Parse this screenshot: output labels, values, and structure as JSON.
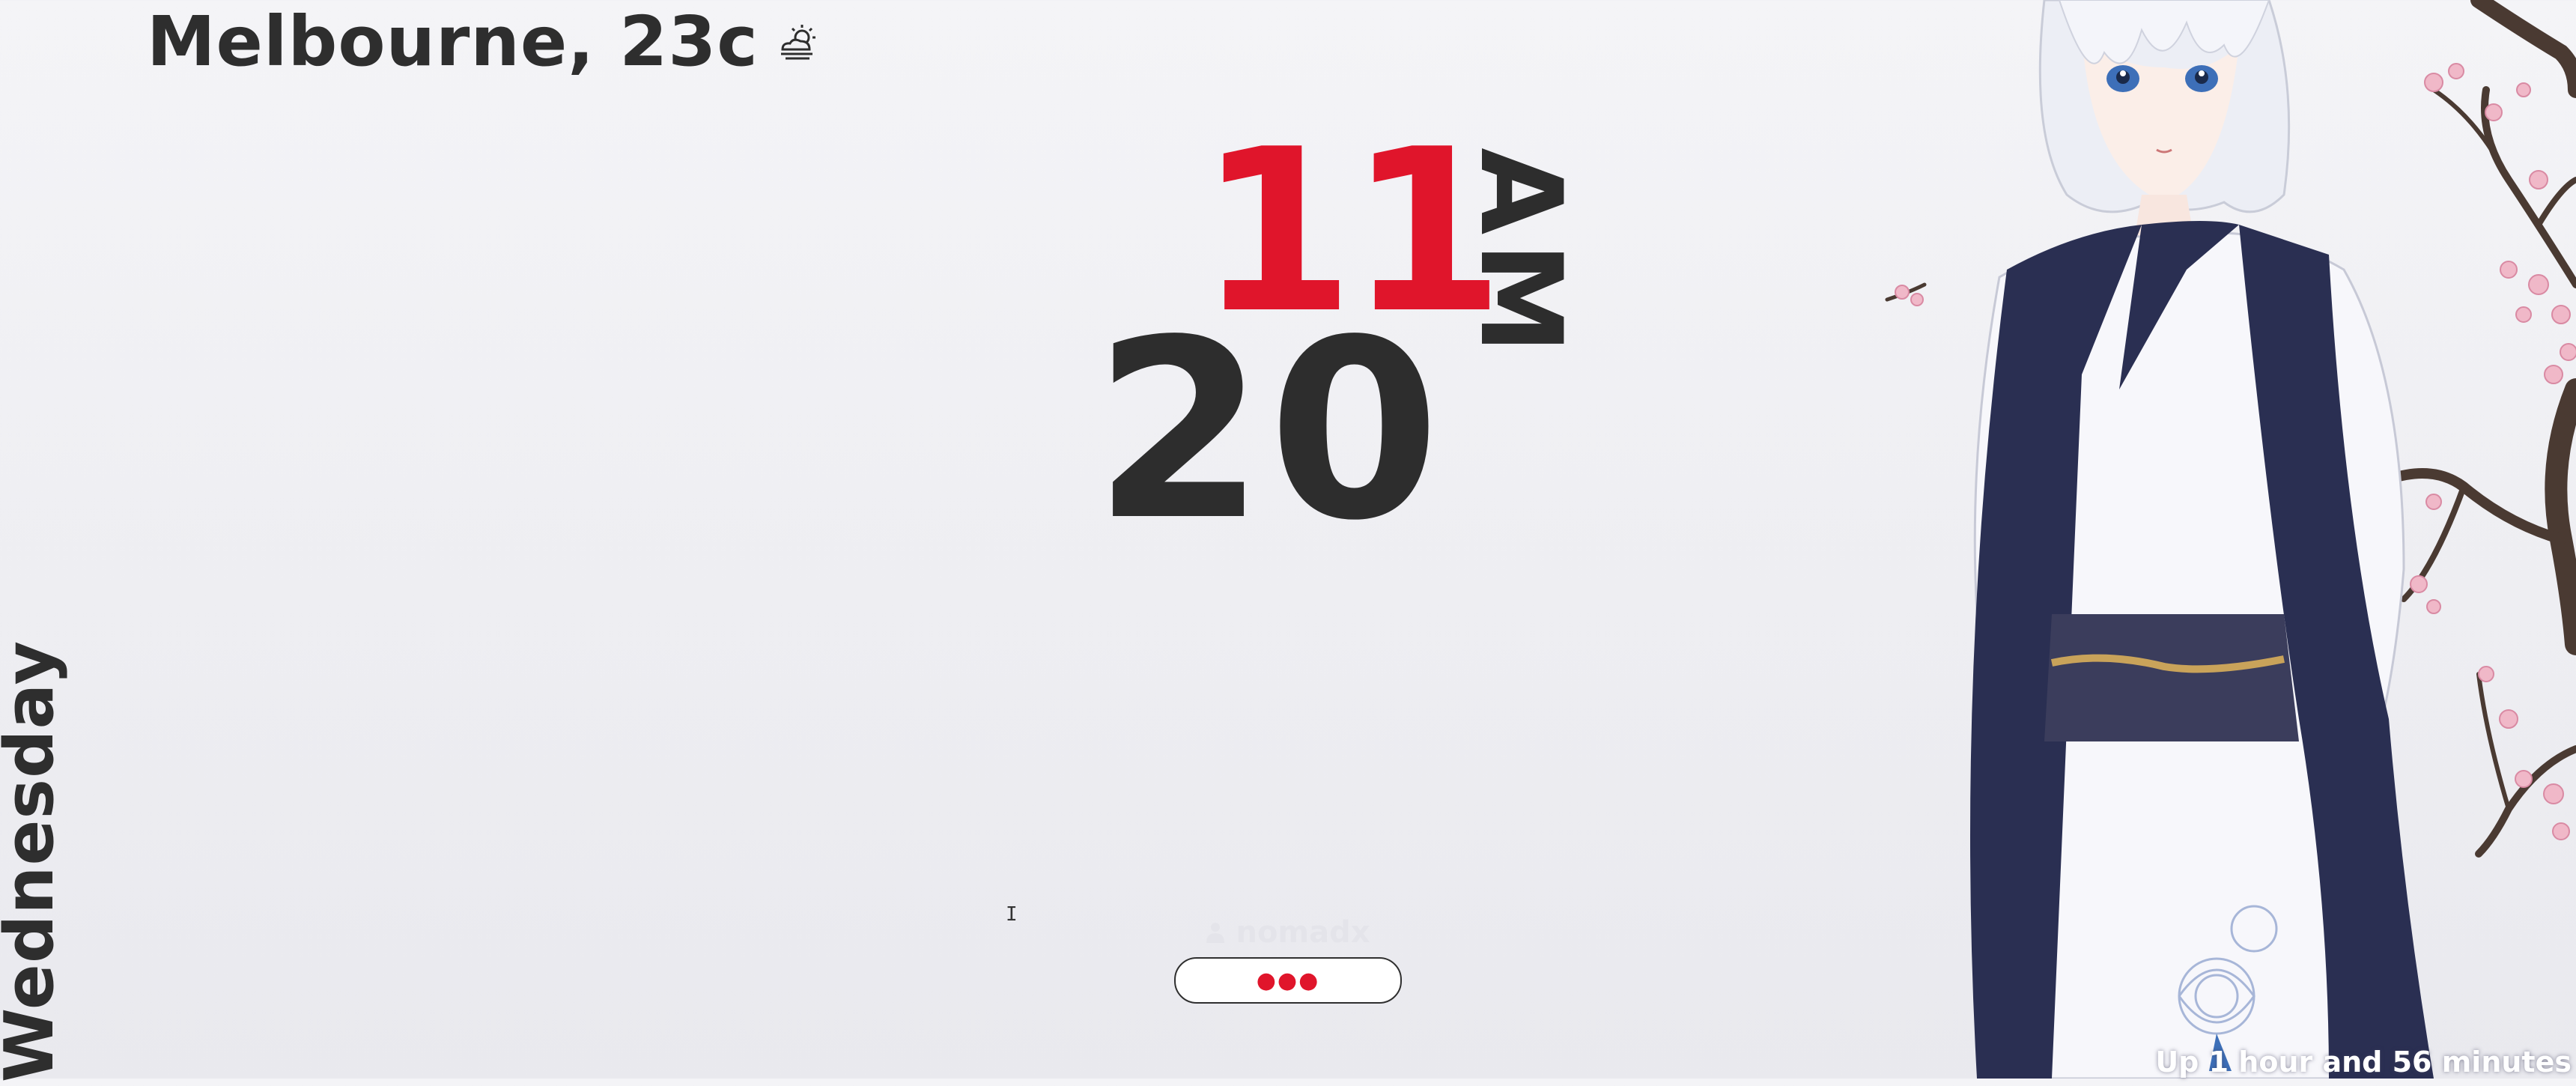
{
  "weather": {
    "text": "Melbourne, 23c",
    "icon": "partly-cloudy-sun-icon"
  },
  "clock": {
    "hour": "11",
    "minute": "20",
    "period": "AM",
    "hour_color": "#e0152b",
    "minute_color": "#2d2d2d"
  },
  "day": "Wednesday",
  "login": {
    "username": "nomadx",
    "user_icon": "user-icon",
    "password_mask": "●●●"
  },
  "uptime": "Up 1 hour and 56 minutes",
  "colors": {
    "accent": "#e0152b",
    "text": "#2e2e2e",
    "background": "#efeff3",
    "kimono_navy": "#2a2f52"
  }
}
